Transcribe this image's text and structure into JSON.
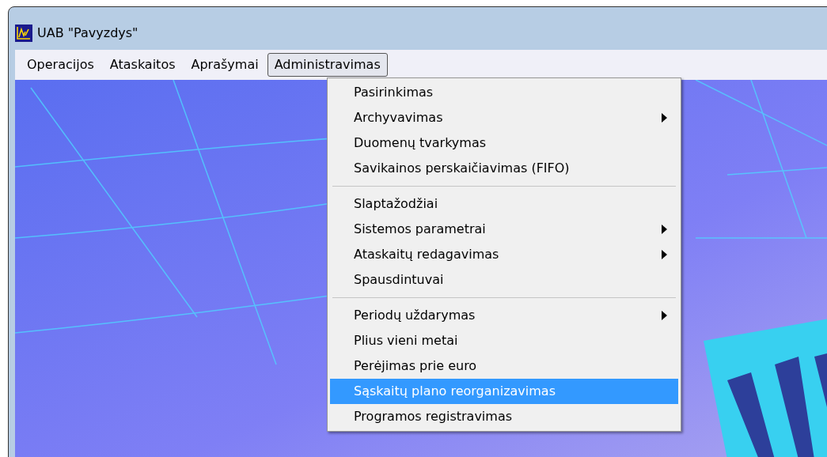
{
  "window": {
    "title": "UAB \"Pavyzdys\""
  },
  "menu_bar": [
    {
      "label": "Operacijos",
      "selected": false
    },
    {
      "label": "Ataskaitos",
      "selected": false
    },
    {
      "label": "Aprašymai",
      "selected": false
    },
    {
      "label": "Administravimas",
      "selected": true
    }
  ],
  "dropdown": {
    "groups": [
      [
        {
          "label": "Pasirinkimas",
          "submenu": false,
          "selected": false
        },
        {
          "label": "Archyvavimas",
          "submenu": true,
          "selected": false
        },
        {
          "label": "Duomenų tvarkymas",
          "submenu": false,
          "selected": false
        },
        {
          "label": "Savikainos perskaičiavimas (FIFO)",
          "submenu": false,
          "selected": false
        }
      ],
      [
        {
          "label": "Slaptažodžiai",
          "submenu": false,
          "selected": false
        },
        {
          "label": "Sistemos parametrai",
          "submenu": true,
          "selected": false
        },
        {
          "label": "Ataskaitų redagavimas",
          "submenu": true,
          "selected": false
        },
        {
          "label": "Spausdintuvai",
          "submenu": false,
          "selected": false
        }
      ],
      [
        {
          "label": "Periodų uždarymas",
          "submenu": true,
          "selected": false
        },
        {
          "label": "Plius vieni metai",
          "submenu": false,
          "selected": false
        },
        {
          "label": "Perėjimas prie euro",
          "submenu": false,
          "selected": false
        },
        {
          "label": "Sąskaitų plano reorganizavimas",
          "submenu": false,
          "selected": true
        },
        {
          "label": "Programos registravimas",
          "submenu": false,
          "selected": false
        }
      ]
    ]
  }
}
